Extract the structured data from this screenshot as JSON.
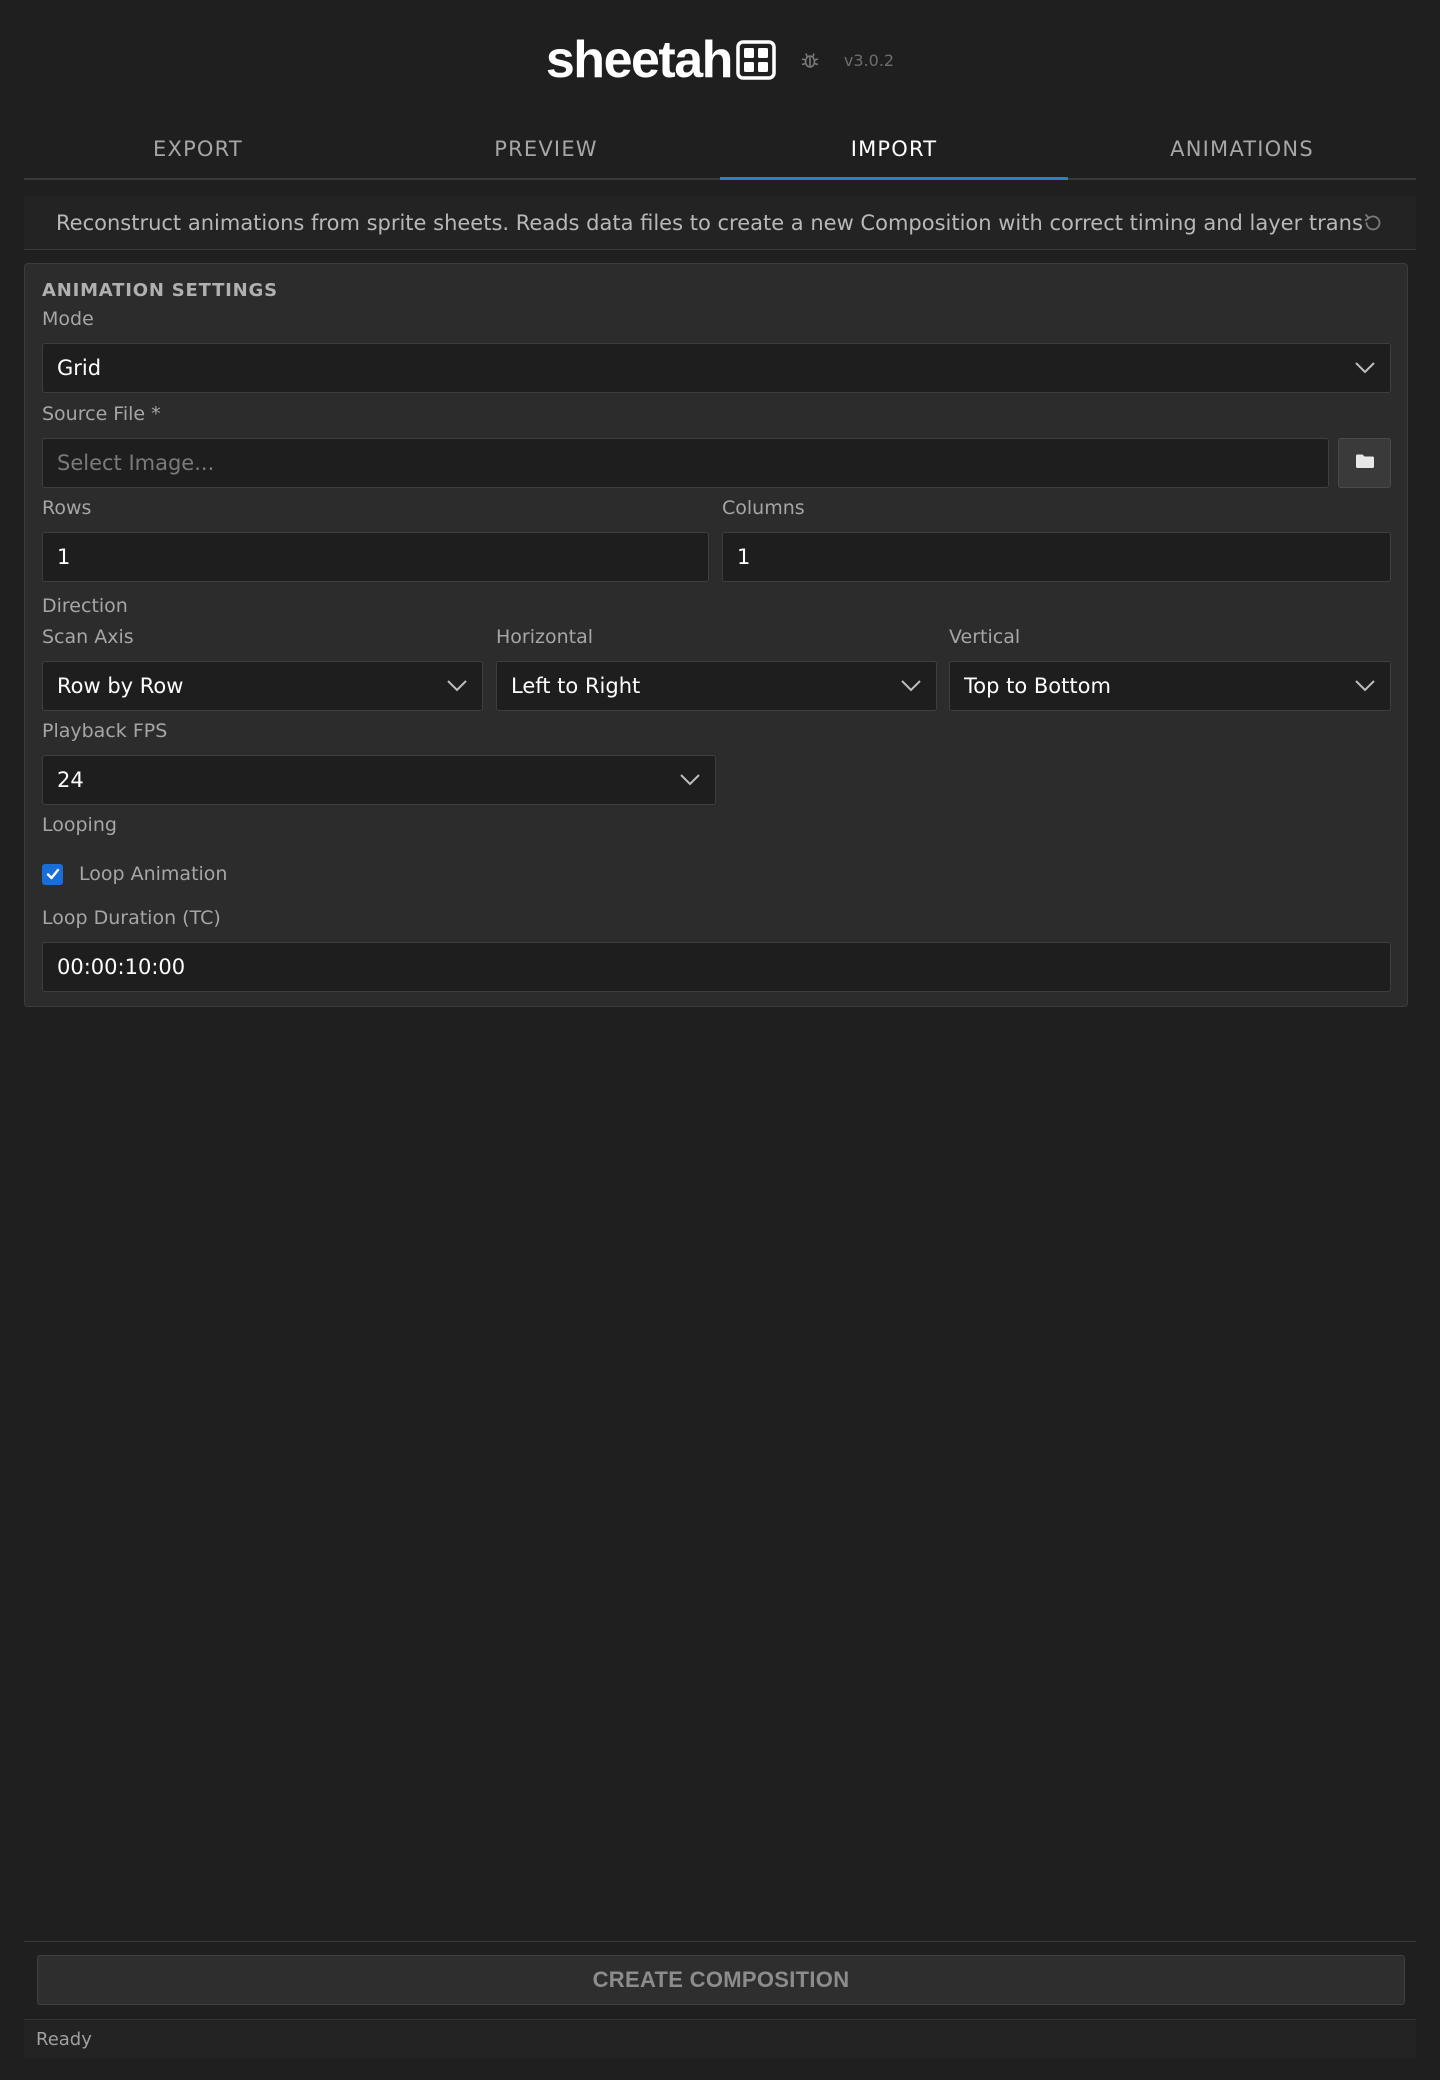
{
  "header": {
    "logo_text": "sheetah",
    "version": "v3.0.2",
    "logo_icon": "grid-icon",
    "debug_icon": "bug-icon"
  },
  "tabs": [
    {
      "label": "EXPORT",
      "active": false
    },
    {
      "label": "PREVIEW",
      "active": false
    },
    {
      "label": "IMPORT",
      "active": true
    },
    {
      "label": "ANIMATIONS",
      "active": false
    }
  ],
  "info": {
    "text": "Reconstruct animations from sprite sheets. Reads data files to create a new Composition with correct timing and layer transforms.",
    "refresh_icon": "refresh-icon"
  },
  "settings": {
    "title": "ANIMATION SETTINGS",
    "mode": {
      "label": "Mode",
      "value": "Grid"
    },
    "source_file": {
      "label": "Source File *",
      "placeholder": "Select Image...",
      "value": "",
      "browse_icon": "folder-icon"
    },
    "rows": {
      "label": "Rows",
      "value": "1"
    },
    "columns": {
      "label": "Columns",
      "value": "1"
    },
    "direction": {
      "label": "Direction",
      "scan_axis": {
        "label": "Scan Axis",
        "value": "Row by Row"
      },
      "horizontal": {
        "label": "Horizontal",
        "value": "Left to Right"
      },
      "vertical": {
        "label": "Vertical",
        "value": "Top to Bottom"
      }
    },
    "fps": {
      "label": "Playback FPS",
      "value": "24"
    },
    "looping": {
      "label": "Looping",
      "loop_label": "Loop Animation",
      "checked": true
    },
    "loop_duration": {
      "label": "Loop Duration (TC)",
      "value": "00:00:10:00"
    }
  },
  "footer": {
    "create_label": "CREATE COMPOSITION",
    "status": "Ready"
  },
  "colors": {
    "background": "#1f1f1f",
    "panel": "#2c2c2c",
    "accent": "#2f7bd6",
    "checkbox": "#1a6ed8"
  }
}
